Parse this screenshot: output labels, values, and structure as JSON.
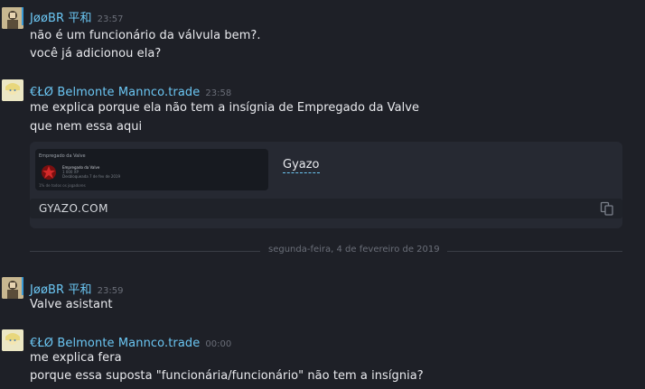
{
  "messages": [
    {
      "username": "JøøBR 平和",
      "timestamp": "23:57",
      "lines": [
        "não é um funcionário da válvula bem?.",
        "você já adicionou ela?"
      ]
    },
    {
      "username": "€ŁØ Belmonte Mannco.trade",
      "timestamp": "23:58",
      "lines": [
        "me explica porque ela não tem a insígnia de Empregado da Valve",
        "que nem essa aqui"
      ]
    },
    {
      "username": "JøøBR 平和",
      "timestamp": "23:59",
      "lines": [
        "Valve asistant"
      ]
    },
    {
      "username": "€ŁØ Belmonte Mannco.trade",
      "timestamp": "00:00",
      "lines": [
        "me explica fera",
        "porque essa suposta \"funcionária/funcionário\" não tem a insígnia?"
      ]
    }
  ],
  "embed": {
    "provider": "Gyazo",
    "domain": "GYAZO.COM",
    "thumb_title": "Empregado da Valve",
    "thumb_line1": "Empregado da Valve",
    "thumb_line2": "1 000 XP",
    "thumb_line3": "Desbloqueada 7 de fev de 2019",
    "thumb_line4": "1% de todos os jogadores"
  },
  "divider_date": "segunda-feira, 4 de fevereiro de 2019",
  "colors": {
    "background": "#1e2027",
    "username": "#6bc6f3",
    "timestamp": "#6a6e78",
    "text": "#e9eaee"
  }
}
